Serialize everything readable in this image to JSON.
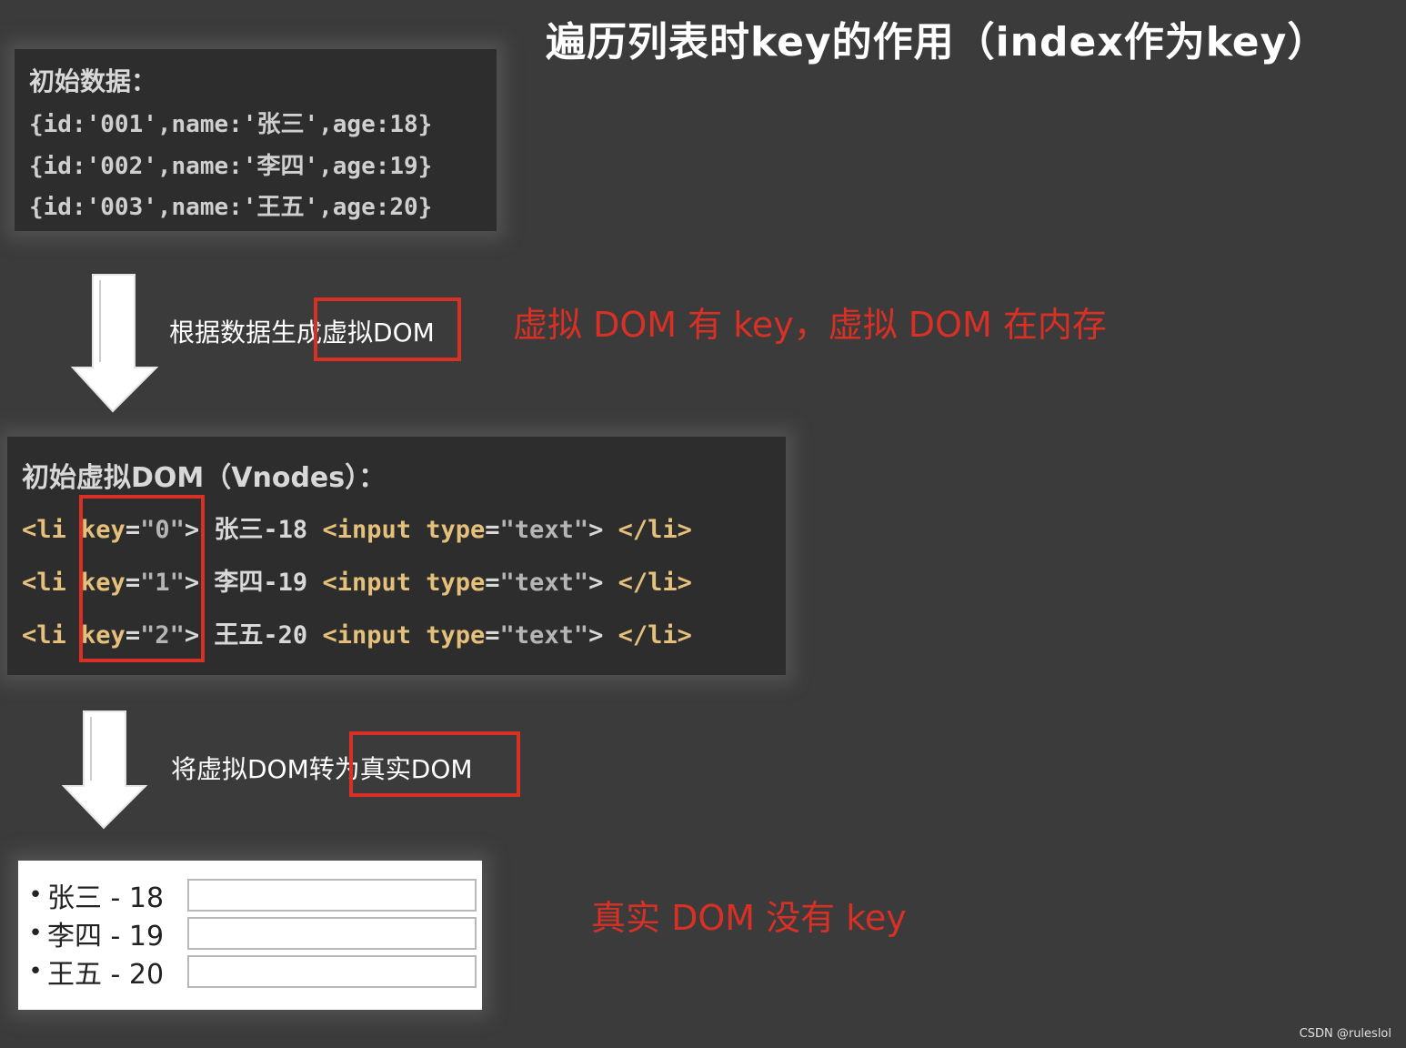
{
  "title": "遍历列表时key的作用（index作为key）",
  "initial_data": {
    "heading": "初始数据：",
    "rows": [
      "{id:'001',name:'张三',age:18}",
      "{id:'002',name:'李四',age:19}",
      "{id:'003',name:'王五',age:20}"
    ]
  },
  "step1": {
    "caption_prefix": "根据数据生成",
    "caption_highlight": "虚拟DOM",
    "note": "虚拟 DOM 有 key，虚拟 DOM 在内存"
  },
  "virtual_dom": {
    "heading": "初始虚拟DOM（Vnodes）：",
    "items": [
      {
        "key": "\"0\"",
        "text": "张三-18"
      },
      {
        "key": "\"1\"",
        "text": "李四-19"
      },
      {
        "key": "\"2\"",
        "text": "王五-20"
      }
    ],
    "open_tag": "<li",
    "key_attr": "key",
    "input_tag": "<input",
    "type_attr": "type",
    "type_value": "\"text\"",
    "close_tag": "</li>"
  },
  "step2": {
    "caption_prefix": "将虚拟DOM转为",
    "caption_highlight": "真实DOM",
    "note": "真实 DOM 没有 key"
  },
  "real_dom": {
    "items": [
      "张三 - 18",
      "李四 - 19",
      "王五 - 20"
    ]
  },
  "watermark": "CSDN @ruleslol",
  "colors": {
    "highlight_red": "#d93025",
    "background": "#3b3b3c",
    "panel": "#2d2d2d"
  }
}
